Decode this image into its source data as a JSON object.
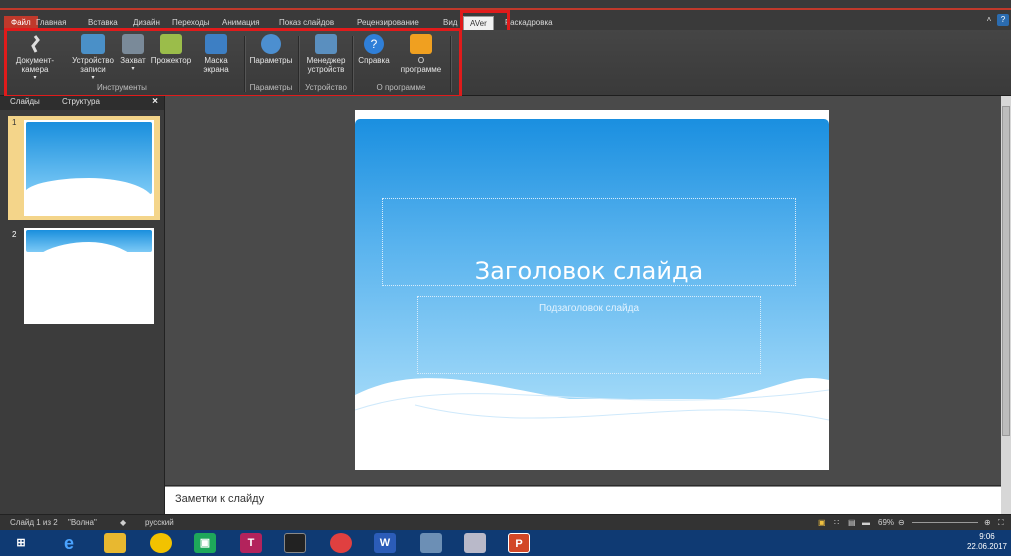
{
  "tabs": {
    "file": "Файл",
    "home": "Главная",
    "insert": "Вставка",
    "design": "Дизайн",
    "transitions": "Переходы",
    "animation": "Анимация",
    "slideshow": "Показ слайдов",
    "review": "Рецензирование",
    "view": "Вид",
    "aver": "AVer",
    "storyboard": "Раскадровка"
  },
  "ribbon": {
    "doc_camera": "Документ-камера",
    "record_device_1": "Устройство",
    "record_device_2": "записи",
    "capture": "Захват",
    "projector": "Прожектор",
    "mask_1": "Маска",
    "mask_2": "экрана",
    "params": "Параметры",
    "manager_1": "Менеджер",
    "manager_2": "устройств",
    "help": "Справка",
    "about_1": "О",
    "about_2": "программе",
    "group_tools": "Инструменты",
    "group_params": "Параметры",
    "group_device": "Устройство",
    "group_about": "О программе"
  },
  "left_panel": {
    "tab_slides": "Слайды",
    "tab_outline": "Структура",
    "slide1_num": "1",
    "slide2_num": "2"
  },
  "slide": {
    "title": "Заголовок слайда",
    "subtitle": "Подзаголовок слайда"
  },
  "notes_placeholder": "Заметки к слайду",
  "status": {
    "slide_of": "Слайд 1 из 2",
    "theme": "\"Волна\"",
    "language": "русский",
    "zoom": "69%"
  },
  "taskbar": {
    "time": "9:06",
    "date": "22.06.2017"
  },
  "colors": {
    "accent_red": "#e01b1b",
    "file_tab": "#c0392b",
    "slide_blue": "#1a8fe0",
    "taskbar": "#0f3a73"
  }
}
